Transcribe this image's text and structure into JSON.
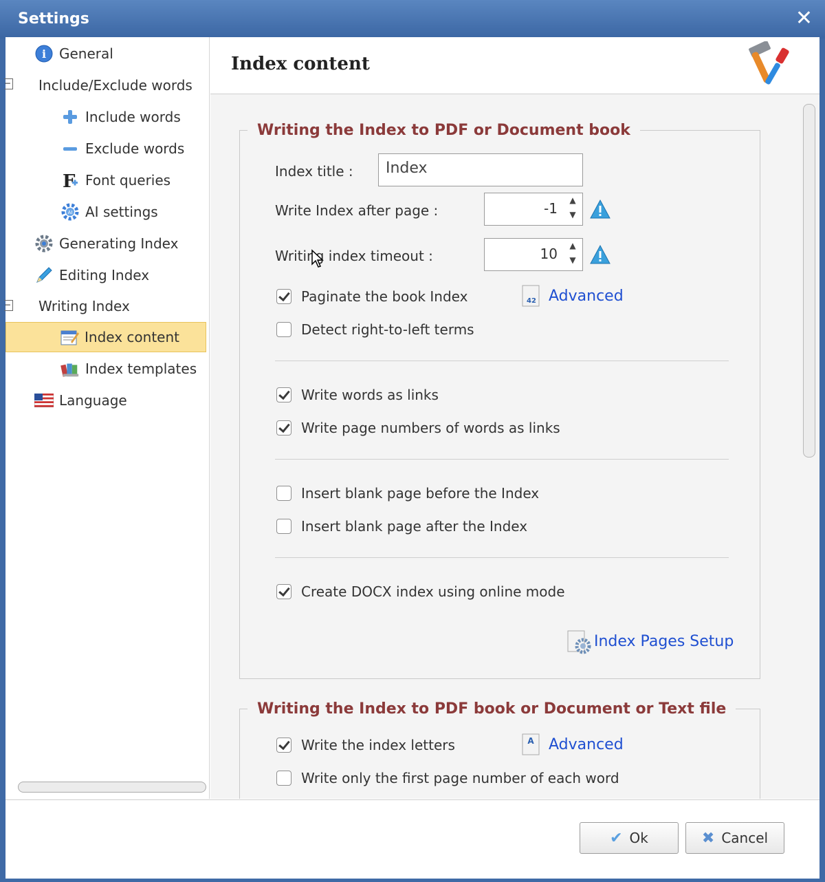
{
  "window": {
    "title": "Settings"
  },
  "sidebar": {
    "items": [
      {
        "label": "General",
        "icon": "info-icon"
      },
      {
        "label": "Include/Exclude words",
        "icon": "none"
      },
      {
        "label": "Include words",
        "icon": "plus-icon"
      },
      {
        "label": "Exclude words",
        "icon": "minus-icon"
      },
      {
        "label": "Font queries",
        "icon": "font-icon"
      },
      {
        "label": "AI settings",
        "icon": "ai-gear-icon"
      },
      {
        "label": "Generating Index",
        "icon": "gear-icon"
      },
      {
        "label": "Editing Index",
        "icon": "pencil-icon"
      },
      {
        "label": "Writing Index",
        "icon": "none"
      },
      {
        "label": "Index content",
        "icon": "index-content-icon",
        "selected": true
      },
      {
        "label": "Index templates",
        "icon": "books-icon"
      },
      {
        "label": "Language",
        "icon": "us-flag-icon"
      }
    ]
  },
  "header": {
    "title": "Index content",
    "icon": "tools-icon"
  },
  "group1": {
    "legend": "Writing the Index to PDF or Document book",
    "index_title_label": "Index title :",
    "index_title_value": "Index",
    "after_page_label": "Write Index after page :",
    "after_page_value": "-1",
    "timeout_label": "Writing index timeout :",
    "timeout_value": "10",
    "paginate": {
      "label": "Paginate the book Index",
      "checked": true
    },
    "advanced1": "Advanced",
    "rtl": {
      "label": "Detect right-to-left terms",
      "checked": false
    },
    "words_links": {
      "label": "Write words as links",
      "checked": true
    },
    "page_links": {
      "label": "Write page numbers of words as links",
      "checked": true
    },
    "blank_before": {
      "label": "Insert blank page before the Index",
      "checked": false
    },
    "blank_after": {
      "label": "Insert blank page after the Index",
      "checked": false
    },
    "docx_online": {
      "label": "Create DOCX index using online mode",
      "checked": true
    },
    "pages_setup": "Index Pages Setup"
  },
  "group2": {
    "legend": "Writing the Index to PDF book or Document or Text file",
    "index_letters": {
      "label": "Write the index letters",
      "checked": true
    },
    "advanced2": "Advanced",
    "first_page_only": {
      "label": "Write only the first page number of each word",
      "checked": false
    }
  },
  "footer": {
    "ok": "Ok",
    "cancel": "Cancel"
  },
  "colors": {
    "accent": "#1f4fd1",
    "legend": "#8b3a3a",
    "selected": "#fbe29a",
    "titlebar": "#3f6aa6"
  }
}
